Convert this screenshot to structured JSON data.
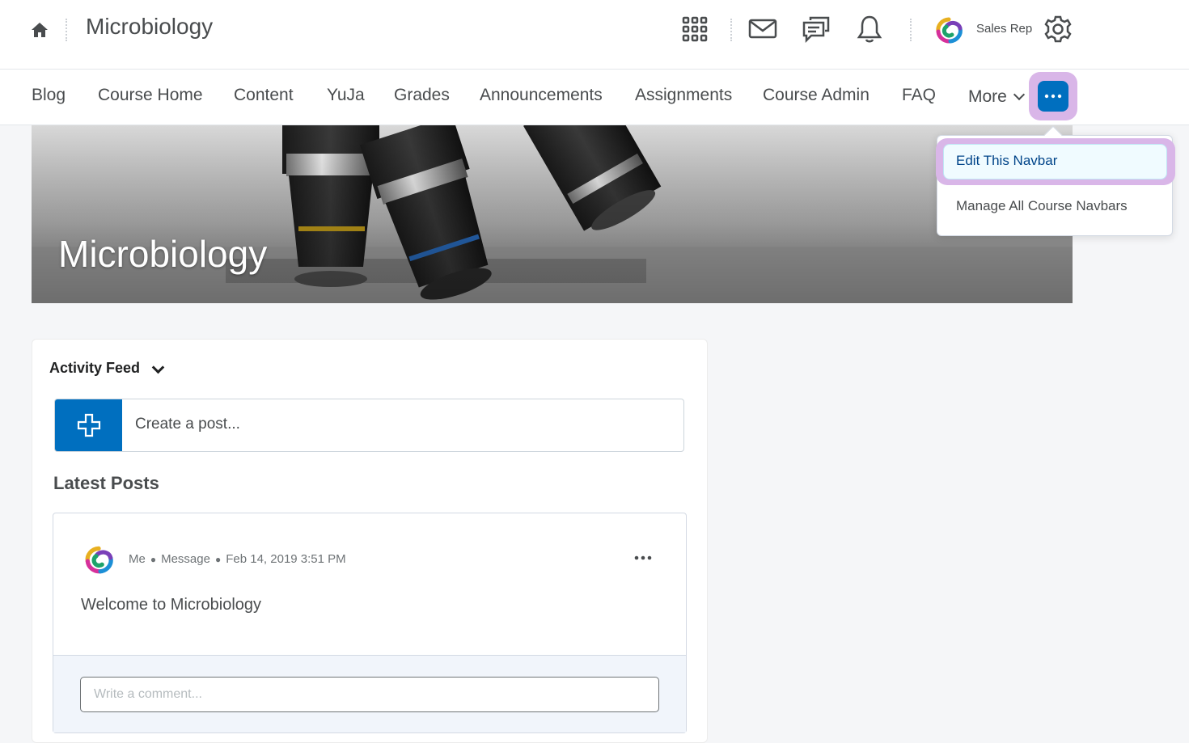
{
  "header": {
    "course_title": "Microbiology",
    "user_name": "Sales Rep"
  },
  "navbar": {
    "items": [
      "Blog",
      "Course Home",
      "Content",
      "YuJa",
      "Grades",
      "Announcements",
      "Assignments",
      "Course Admin",
      "FAQ"
    ],
    "more_label": "More"
  },
  "banner": {
    "title": "Microbiology"
  },
  "dropdown": {
    "items": [
      "Edit This Navbar",
      "Manage All Course Navbars"
    ]
  },
  "feed": {
    "title": "Activity Feed",
    "create_placeholder": "Create a post...",
    "latest_title": "Latest Posts",
    "post": {
      "author": "Me",
      "type": "Message",
      "date": "Feb 14, 2019 3:51 PM",
      "body": "Welcome to Microbiology"
    },
    "comment_placeholder": "Write a comment..."
  },
  "colors": {
    "brand_blue": "#006fbf",
    "highlight_ring": "#d9b6e8"
  }
}
